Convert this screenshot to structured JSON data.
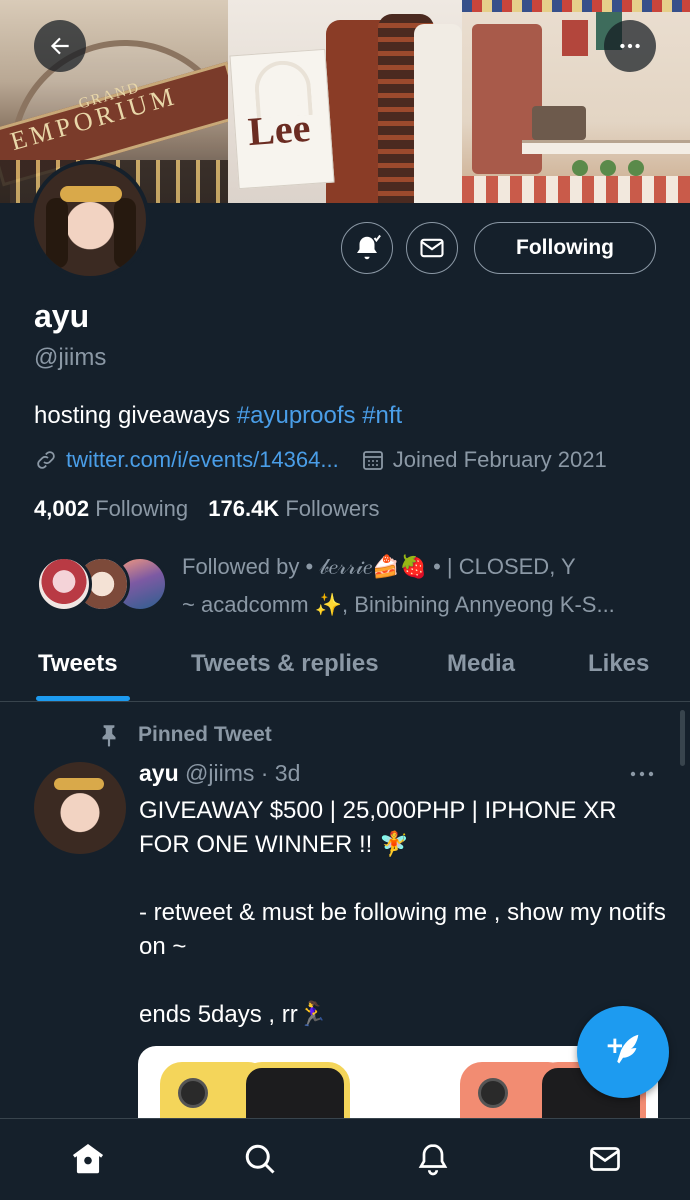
{
  "banner": {
    "sign_small": "GRAND",
    "sign_large": "EMPORIUM",
    "bag_logo": "Lee"
  },
  "profile": {
    "name": "ayu",
    "handle": "@jiims",
    "bio_text": "hosting giveaways ",
    "bio_hashtags": "#ayuproofs #nft",
    "link": "twitter.com/i/events/14364...",
    "joined": "Joined February 2021",
    "following_count": "4,002",
    "following_label": "Following",
    "followers_count": "176.4K",
    "followers_label": "Followers",
    "followed_by_line1": "Followed by • 𝒷𝑒𝓇𝓇𝒾𝑒🍰🍓 • | CLOSED, Y",
    "followed_by_line2": "~ acadcomm ✨, Binibining Annyeong K-S..."
  },
  "actions": {
    "following_button": "Following"
  },
  "tabs": [
    {
      "label": "Tweets",
      "active": true
    },
    {
      "label": "Tweets & replies",
      "active": false
    },
    {
      "label": "Media",
      "active": false
    },
    {
      "label": "Likes",
      "active": false
    }
  ],
  "pinned_tweet": {
    "pinned_label": "Pinned Tweet",
    "author_name": "ayu",
    "author_meta": "@jiims · 3d",
    "body_line1": "GIVEAWAY $500 | 25,000PHP | IPHONE XR FOR ONE WINNER !! 🧚",
    "body_line2": "- retweet & must be following me , show my notifs on ~",
    "body_line3": "ends 5days , rr🏃‍♀️"
  },
  "icons": {
    "back": "back-arrow-icon",
    "more": "more-horizontal-icon",
    "notifications": "bell-check-icon",
    "message": "envelope-icon",
    "link": "link-icon",
    "calendar": "calendar-icon",
    "pin": "pin-icon",
    "compose": "compose-tweet-icon",
    "home": "home-icon",
    "search": "search-icon",
    "bell": "bell-icon",
    "mail": "mail-icon"
  },
  "colors": {
    "background": "#15202b",
    "accent": "#1d9bf0",
    "link": "#4a9ee8",
    "muted_text": "#8b98a5",
    "border": "#38444d"
  }
}
